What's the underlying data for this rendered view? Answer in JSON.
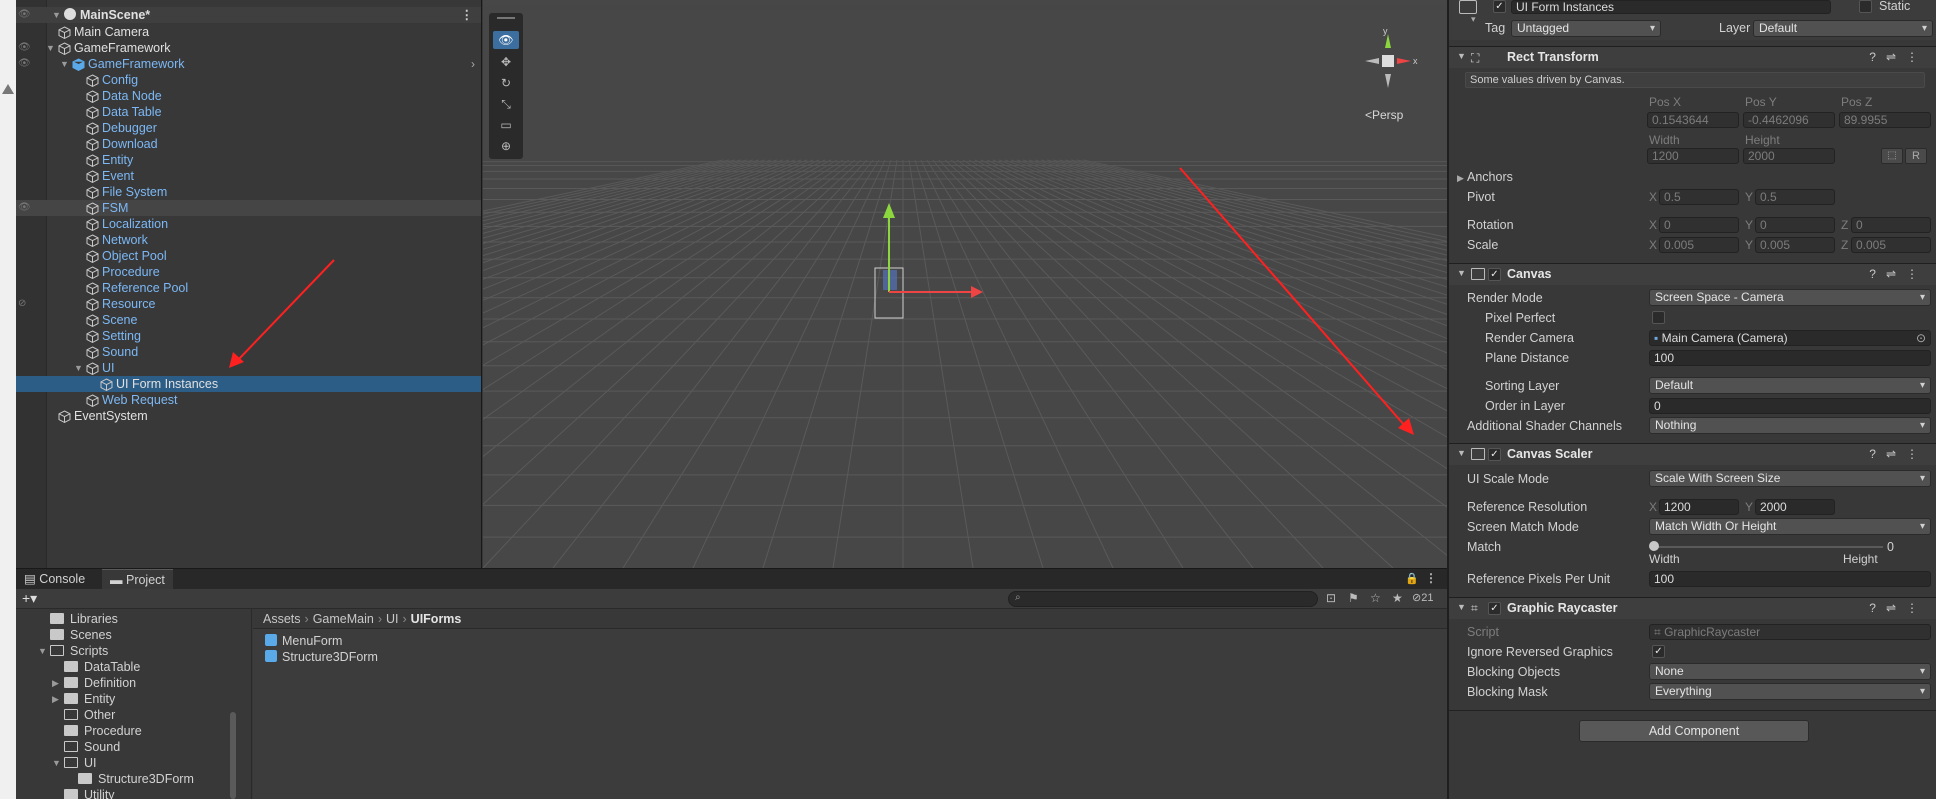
{
  "hierarchy": {
    "scene_name": "MainScene*",
    "items": [
      {
        "label": "Main Camera",
        "color": "white"
      },
      {
        "label": "GameFramework",
        "color": "white"
      },
      {
        "label": "GameFramework",
        "color": "blue"
      },
      {
        "label": "Config",
        "color": "blue"
      },
      {
        "label": "Data Node",
        "color": "blue"
      },
      {
        "label": "Data Table",
        "color": "blue"
      },
      {
        "label": "Debugger",
        "color": "blue"
      },
      {
        "label": "Download",
        "color": "blue"
      },
      {
        "label": "Entity",
        "color": "blue"
      },
      {
        "label": "Event",
        "color": "blue"
      },
      {
        "label": "File System",
        "color": "blue"
      },
      {
        "label": "FSM",
        "color": "blue"
      },
      {
        "label": "Localization",
        "color": "blue"
      },
      {
        "label": "Network",
        "color": "blue"
      },
      {
        "label": "Object Pool",
        "color": "blue"
      },
      {
        "label": "Procedure",
        "color": "blue"
      },
      {
        "label": "Reference Pool",
        "color": "blue"
      },
      {
        "label": "Resource",
        "color": "blue"
      },
      {
        "label": "Scene",
        "color": "blue"
      },
      {
        "label": "Setting",
        "color": "blue"
      },
      {
        "label": "Sound",
        "color": "blue"
      },
      {
        "label": "UI",
        "color": "blue"
      },
      {
        "label": "UI Form Instances",
        "color": "white"
      },
      {
        "label": "Web Request",
        "color": "blue"
      },
      {
        "label": "EventSystem",
        "color": "white"
      }
    ]
  },
  "scene": {
    "persp_label": "<Persp",
    "gizmo_y": "y",
    "gizmo_x": "x"
  },
  "inspector": {
    "object_name": "UI Form Instances",
    "static_label": "Static",
    "tag_label": "Tag",
    "tag_value": "Untagged",
    "layer_label": "Layer",
    "layer_value": "Default",
    "rect_transform": {
      "title": "Rect Transform",
      "note": "Some values driven by Canvas.",
      "pos_x_label": "Pos X",
      "pos_y_label": "Pos Y",
      "pos_z_label": "Pos Z",
      "pos_x": "0.1543644",
      "pos_y": "-0.4462096",
      "pos_z": "89.9955",
      "width_label": "Width",
      "height_label": "Height",
      "width": "1200",
      "height": "2000",
      "r_button": "R",
      "anchors_label": "Anchors",
      "pivot_label": "Pivot",
      "pivot_x": "0.5",
      "pivot_y": "0.5",
      "rotation_label": "Rotation",
      "rot_x": "0",
      "rot_y": "0",
      "rot_z": "0",
      "scale_label": "Scale",
      "scale_x": "0.005",
      "scale_y": "0.005",
      "scale_z": "0.005",
      "x": "X",
      "y": "Y",
      "z": "Z"
    },
    "canvas": {
      "title": "Canvas",
      "render_mode_label": "Render Mode",
      "render_mode": "Screen Space - Camera",
      "pixel_perfect_label": "Pixel Perfect",
      "render_camera_label": "Render Camera",
      "render_camera": "Main Camera (Camera)",
      "plane_distance_label": "Plane Distance",
      "plane_distance": "100",
      "sorting_layer_label": "Sorting Layer",
      "sorting_layer": "Default",
      "order_in_layer_label": "Order in Layer",
      "order_in_layer": "0",
      "shader_channels_label": "Additional Shader Channels",
      "shader_channels": "Nothing"
    },
    "canvas_scaler": {
      "title": "Canvas Scaler",
      "ui_scale_mode_label": "UI Scale Mode",
      "ui_scale_mode": "Scale With Screen Size",
      "ref_res_label": "Reference Resolution",
      "ref_res_x": "1200",
      "ref_res_y": "2000",
      "screen_match_label": "Screen Match Mode",
      "screen_match": "Match Width Or Height",
      "match_label": "Match",
      "match_value": "0",
      "match_width": "Width",
      "match_height": "Height",
      "ref_ppu_label": "Reference Pixels Per Unit",
      "ref_ppu": "100"
    },
    "graphic_raycaster": {
      "title": "Graphic Raycaster",
      "script_label": "Script",
      "script_value": "GraphicRaycaster",
      "ignore_reversed_label": "Ignore Reversed Graphics",
      "blocking_objects_label": "Blocking Objects",
      "blocking_objects": "None",
      "blocking_mask_label": "Blocking Mask",
      "blocking_mask": "Everything"
    },
    "add_component": "Add Component"
  },
  "bottom": {
    "tab_console": "Console",
    "tab_project": "Project",
    "hidden_count": "21",
    "folders": [
      {
        "label": "Libraries",
        "indent": 1,
        "open": false,
        "arrow": ""
      },
      {
        "label": "Scenes",
        "indent": 1,
        "open": false,
        "arrow": ""
      },
      {
        "label": "Scripts",
        "indent": 1,
        "open": true,
        "arrow": "▼"
      },
      {
        "label": "DataTable",
        "indent": 2,
        "open": false,
        "arrow": ""
      },
      {
        "label": "Definition",
        "indent": 2,
        "open": false,
        "arrow": "▶"
      },
      {
        "label": "Entity",
        "indent": 2,
        "open": false,
        "arrow": "▶"
      },
      {
        "label": "Other",
        "indent": 2,
        "open": true,
        "arrow": ""
      },
      {
        "label": "Procedure",
        "indent": 2,
        "open": false,
        "arrow": ""
      },
      {
        "label": "Sound",
        "indent": 2,
        "open": true,
        "arrow": ""
      },
      {
        "label": "UI",
        "indent": 2,
        "open": true,
        "arrow": "▼"
      },
      {
        "label": "Structure3DForm",
        "indent": 3,
        "open": false,
        "arrow": ""
      },
      {
        "label": "Utility",
        "indent": 2,
        "open": false,
        "arrow": ""
      }
    ],
    "breadcrumb": [
      "Assets",
      "GameMain",
      "UI",
      "UIForms"
    ],
    "assets": [
      "MenuForm",
      "Structure3DForm"
    ]
  },
  "colors": {
    "selection": "#2c5d87",
    "prefab_blue": "#7cb8f5",
    "annotation_red": "#ff2020"
  }
}
